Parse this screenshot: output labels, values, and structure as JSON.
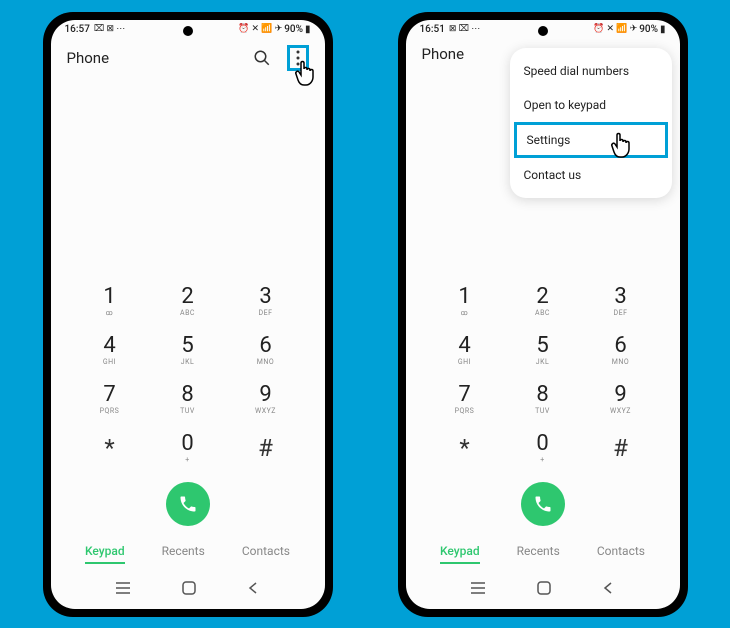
{
  "status": {
    "time1": "16:57",
    "time2": "16:51",
    "battery": "90%"
  },
  "app": {
    "title": "Phone"
  },
  "keypad": [
    {
      "num": "1",
      "sub": "ꝏ"
    },
    {
      "num": "2",
      "sub": "ABC"
    },
    {
      "num": "3",
      "sub": "DEF"
    },
    {
      "num": "4",
      "sub": "GHI"
    },
    {
      "num": "5",
      "sub": "JKL"
    },
    {
      "num": "6",
      "sub": "MNO"
    },
    {
      "num": "7",
      "sub": "PQRS"
    },
    {
      "num": "8",
      "sub": "TUV"
    },
    {
      "num": "9",
      "sub": "WXYZ"
    },
    {
      "num": "*",
      "sub": ""
    },
    {
      "num": "0",
      "sub": "+"
    },
    {
      "num": "#",
      "sub": ""
    }
  ],
  "tabs": {
    "keypad": "Keypad",
    "recents": "Recents",
    "contacts": "Contacts"
  },
  "menu": {
    "speedDial": "Speed dial numbers",
    "openKeypad": "Open to keypad",
    "settings": "Settings",
    "contactUs": "Contact us"
  }
}
